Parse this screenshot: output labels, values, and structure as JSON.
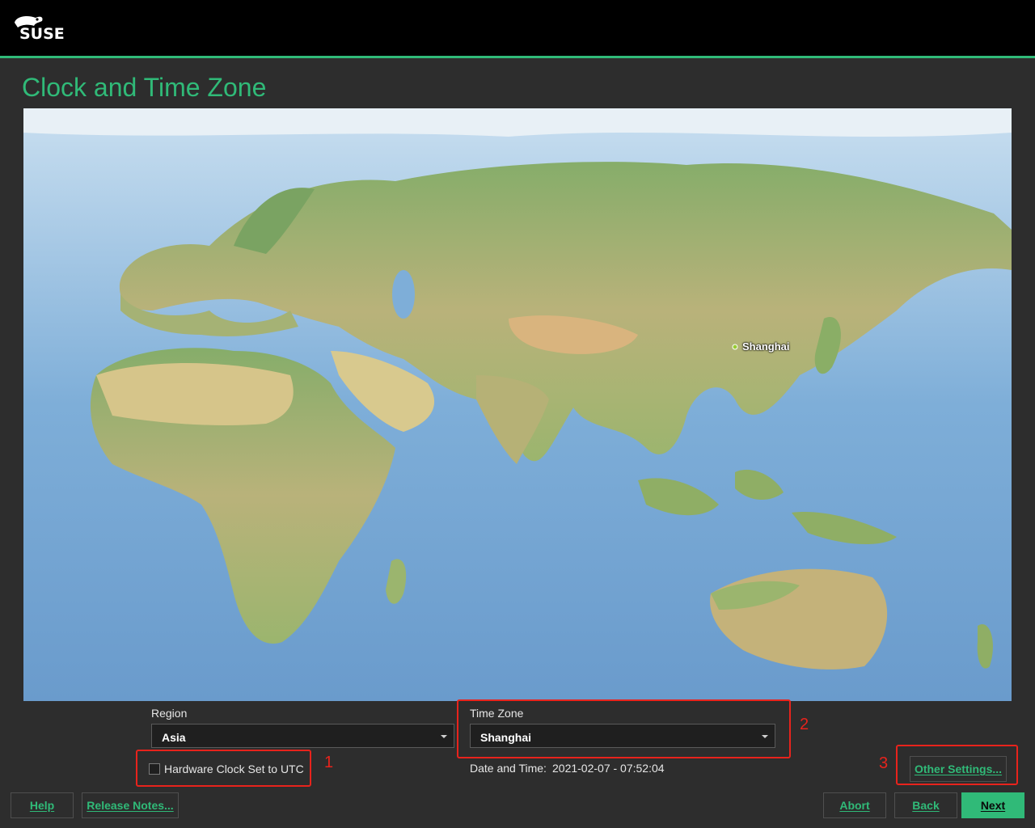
{
  "brand": {
    "name": "SUSE",
    "accent": "#30ba78"
  },
  "page": {
    "title": "Clock and Time Zone"
  },
  "map": {
    "selected_city_label": "Shanghai"
  },
  "region": {
    "label": "Region",
    "value": "Asia"
  },
  "timezone": {
    "label": "Time Zone",
    "value": "Shanghai"
  },
  "hardware_clock": {
    "label": "Hardware Clock Set to UTC",
    "checked": false
  },
  "datetime": {
    "label": "Date and Time:",
    "value": "2021-02-07 - 07:52:04"
  },
  "buttons": {
    "other_settings": "Other Settings...",
    "help": "Help",
    "release_notes": "Release Notes...",
    "abort": "Abort",
    "back": "Back",
    "next": "Next"
  },
  "callouts": {
    "one": "1",
    "two": "2",
    "three": "3",
    "color": "#e8231c"
  }
}
